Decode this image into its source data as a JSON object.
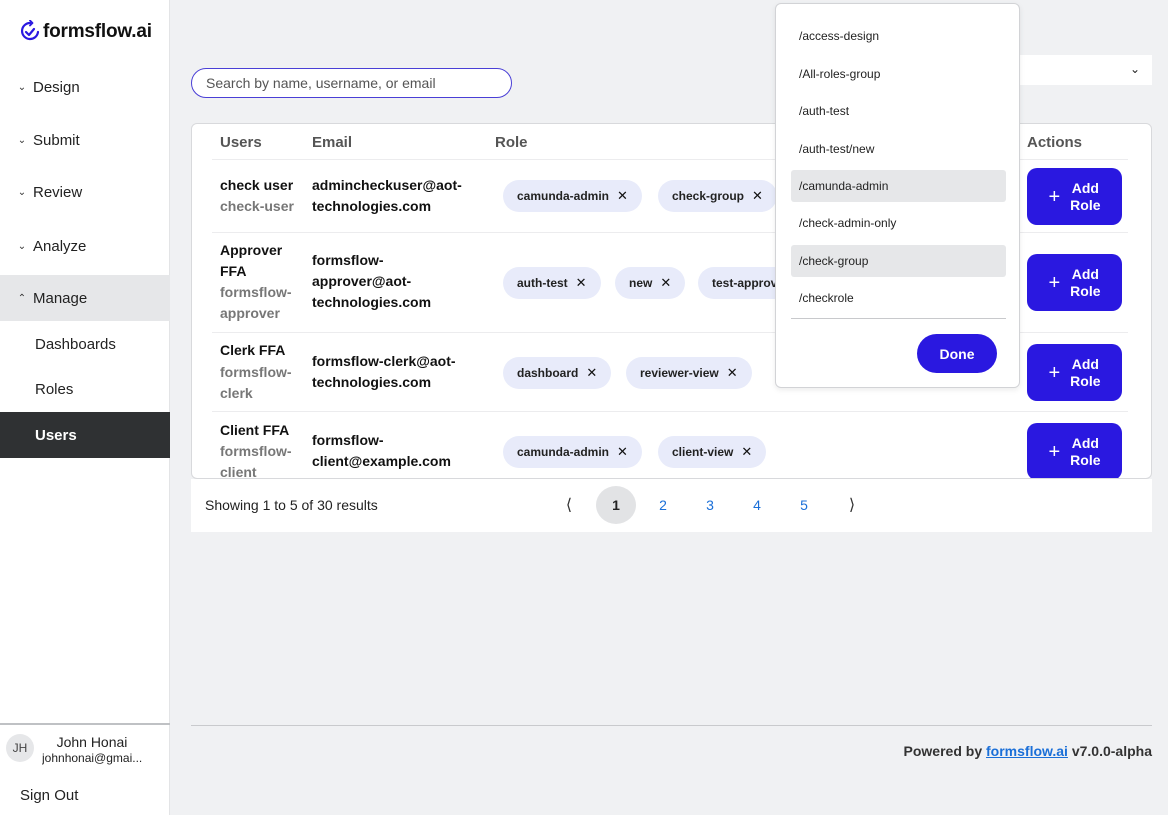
{
  "app": {
    "name": "formsflow.ai"
  },
  "sidebar": {
    "groups": [
      {
        "label": "Design",
        "chevron": "chevron-down-icon"
      },
      {
        "label": "Submit",
        "chevron": "chevron-down-icon"
      },
      {
        "label": "Review",
        "chevron": "chevron-down-icon"
      },
      {
        "label": "Analyze",
        "chevron": "chevron-down-icon"
      },
      {
        "label": "Manage",
        "chevron": "chevron-up-icon"
      }
    ],
    "manage_items": [
      {
        "label": "Dashboards"
      },
      {
        "label": "Roles"
      },
      {
        "label": "Users"
      }
    ],
    "user": {
      "initials": "JH",
      "name": "John Honai",
      "email": "johnhonai@gmai..."
    },
    "sign_out": "Sign Out"
  },
  "search": {
    "placeholder": "Search by name, username, or email"
  },
  "table": {
    "headers": {
      "users": "Users",
      "email": "Email",
      "role": "Role",
      "actions": "Actions"
    },
    "add_role_label_1": "Add",
    "add_role_label_2": "Role",
    "rows": [
      {
        "name": "check user",
        "handle": "check-user",
        "email": "admincheckuser@aot-technologies.com",
        "email_lines": [
          "admincheckuser@aot-",
          "technologies.com"
        ],
        "roles": [
          "camunda-admin",
          "check-group"
        ]
      },
      {
        "name": "Approver FFA",
        "name_lines": [
          "Approver",
          "FFA"
        ],
        "handle_lines": [
          "formsflow-",
          "approver"
        ],
        "email_lines": [
          "formsflow-",
          "approver@aot-",
          "technologies.com"
        ],
        "roles": [
          "auth-test",
          "new",
          "test-approv"
        ]
      },
      {
        "name": "Clerk FFA",
        "handle_lines": [
          "formsflow-",
          "clerk"
        ],
        "email_lines": [
          "formsflow-clerk@aot-",
          "technologies.com"
        ],
        "roles": [
          "dashboard",
          "reviewer-view"
        ]
      },
      {
        "name": "Client FFA",
        "handle_lines": [
          "formsflow-",
          "client"
        ],
        "email_lines": [
          "formsflow-",
          "client@example.com"
        ],
        "roles": [
          "camunda-admin",
          "client-view"
        ]
      }
    ]
  },
  "pagination": {
    "summary": "Showing 1 to 5 of 30 results",
    "prev": "⟨",
    "next": "⟩",
    "pages": [
      "1",
      "2",
      "3",
      "4",
      "5"
    ],
    "current": "1"
  },
  "footer": {
    "prefix": "Powered by",
    "link": "formsflow.ai",
    "version": "v7.0.0-alpha"
  },
  "role_dropdown": {
    "options": [
      "/access-design",
      "/All-roles-group",
      "/auth-test",
      "/auth-test/new",
      "/camunda-admin",
      "/check-admin-only",
      "/check-group",
      "/checkrole"
    ],
    "selected": [
      "/camunda-admin",
      "/check-group"
    ],
    "done_label": "Done"
  },
  "colors": {
    "accent": "#2a18e0",
    "link": "#1a6fd8",
    "chip_bg": "#e8ebfa",
    "sidebar_active": "#2f3133"
  }
}
